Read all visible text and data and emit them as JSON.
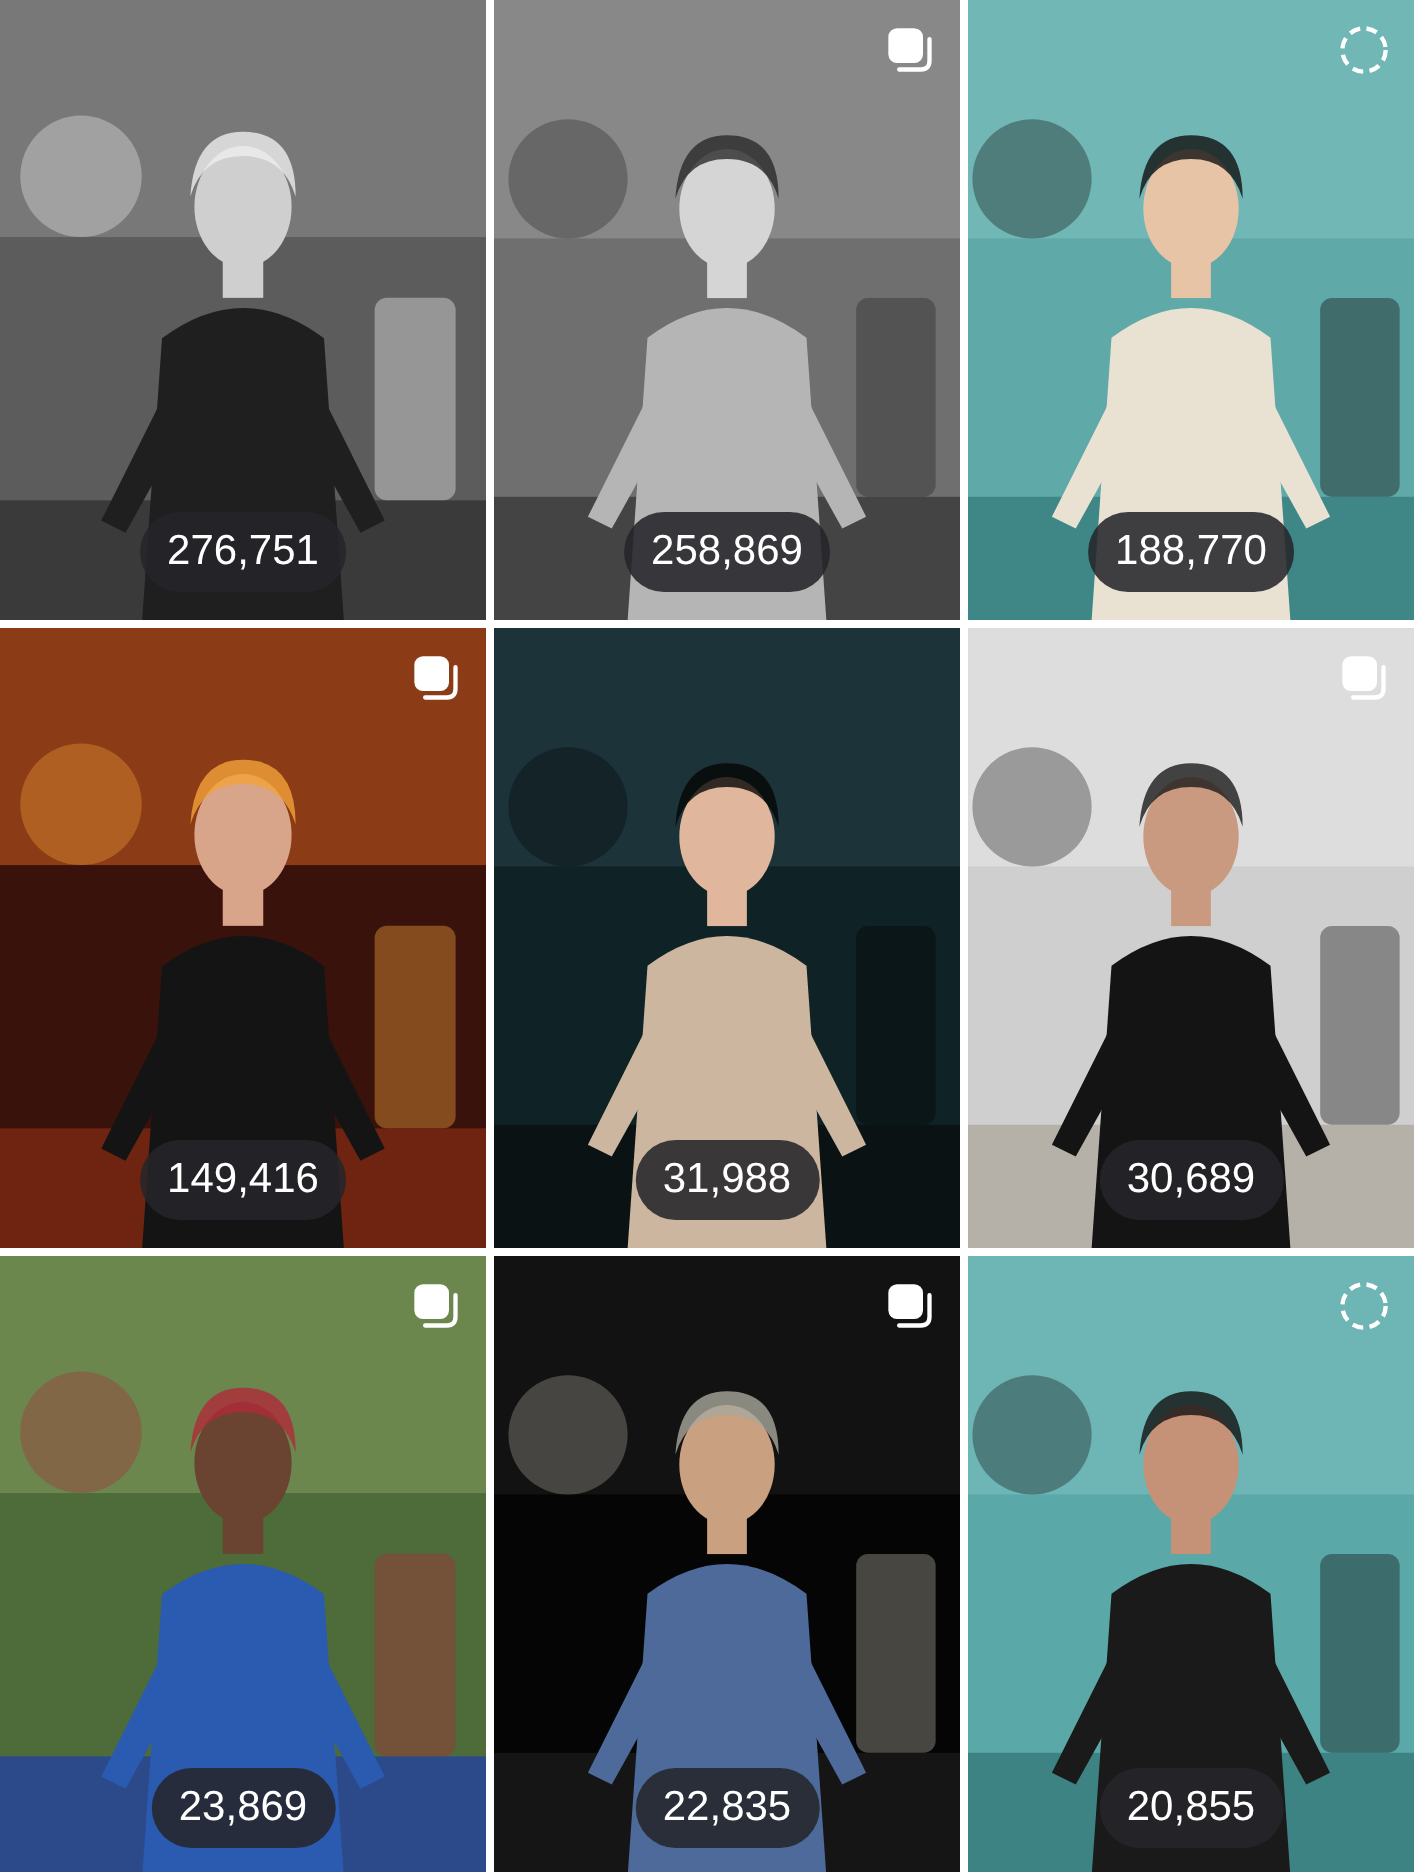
{
  "posts": [
    {
      "views": "276,751"
    },
    {
      "kind": "carousel",
      "views": "258,869"
    },
    {
      "kind": "clip",
      "views": "188,770"
    },
    {
      "kind": "carousel",
      "views": "149,416"
    },
    {
      "views": "31,988"
    },
    {
      "kind": "carousel",
      "views": "30,689"
    },
    {
      "kind": "carousel",
      "views": "23,869"
    },
    {
      "kind": "carousel",
      "views": "22,835"
    },
    {
      "kind": "clip",
      "views": "20,855"
    }
  ]
}
